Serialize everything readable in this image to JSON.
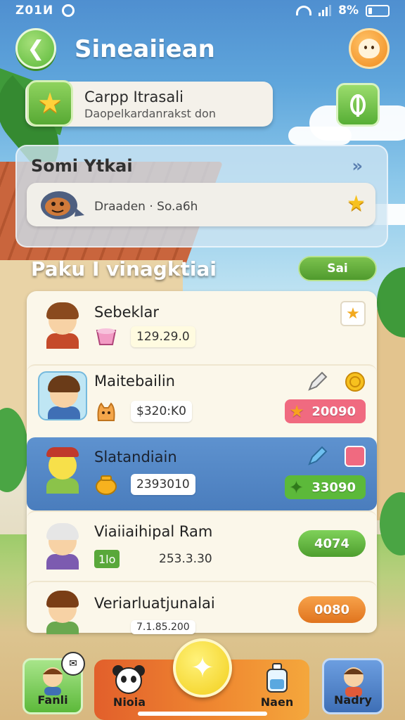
{
  "status": {
    "time": "Z01И",
    "battery": "8%"
  },
  "header": {
    "title": "Sineaiiean",
    "back_icon": "back-arrow-icon",
    "profile_icon": "profile-avatar-icon"
  },
  "quest": {
    "title": "Carpp Itrasali",
    "subtitle": "Daopelkardanrakst don"
  },
  "summary": {
    "title": "Somi Ytkai",
    "text": "Draaden · So.a6h"
  },
  "section": {
    "title": "Paku I vinagktiai",
    "button": "Sai"
  },
  "rows": [
    {
      "name": "Sebeklar",
      "value": "129.29.0"
    },
    {
      "name": "Maitebailin",
      "value": "$320:K0",
      "reward": "20090"
    },
    {
      "name": "Slatandiain",
      "value": "2393010",
      "reward": "33090"
    },
    {
      "name": "Viaiiaihipal Ram",
      "badge": "1lo",
      "value": "253.3.30",
      "action": "4074"
    },
    {
      "name": "Veriarluatjunalai",
      "value": "7.1.85.200",
      "action": "0080"
    }
  ],
  "nav": [
    {
      "label": "Fanli"
    },
    {
      "label": "Nioia"
    },
    {
      "label": "Naen"
    },
    {
      "label": "Nadry"
    }
  ],
  "colors": {
    "accent_green": "#59a83a",
    "highlight_blue": "#4a7dbd",
    "reward_pink": "#f06a80",
    "action_orange": "#f08a31",
    "star_yellow": "#f7c11e"
  }
}
